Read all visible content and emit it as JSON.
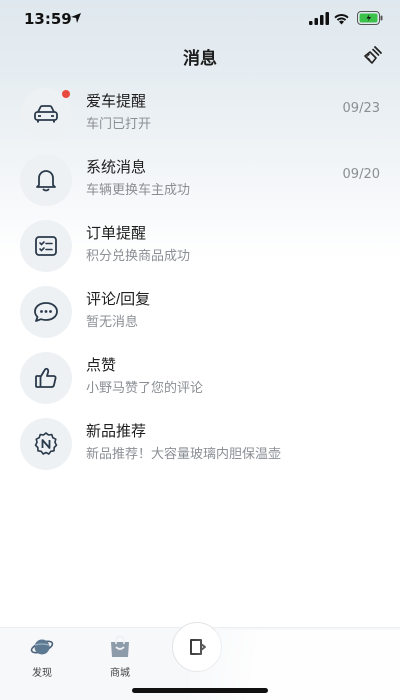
{
  "status_bar": {
    "time": "13:59"
  },
  "header": {
    "title": "消息",
    "clear_icon": "broom-icon"
  },
  "messages": [
    {
      "icon": "car-icon",
      "title": "爱车提醒",
      "subtitle": "车门已打开",
      "date": "09/23",
      "unread": true
    },
    {
      "icon": "bell-icon",
      "title": "系统消息",
      "subtitle": "车辆更换车主成功",
      "date": "09/20",
      "unread": false
    },
    {
      "icon": "order-list-icon",
      "title": "订单提醒",
      "subtitle": "积分兑换商品成功",
      "date": "",
      "unread": false
    },
    {
      "icon": "comment-bubble-icon",
      "title": "评论/回复",
      "subtitle": "暂无消息",
      "date": "",
      "unread": false
    },
    {
      "icon": "thumbs-up-icon",
      "title": "点赞",
      "subtitle": "小野马赞了您的评论",
      "date": "",
      "unread": false
    },
    {
      "icon": "new-product-badge-icon",
      "title": "新品推荐",
      "subtitle": "新品推荐！大容量玻璃内胆保温壶",
      "date": "",
      "unread": false
    }
  ],
  "tab_bar": {
    "tabs": [
      {
        "label": "发现",
        "icon": "planet-icon"
      },
      {
        "label": "商城",
        "icon": "shopping-bag-icon"
      }
    ]
  },
  "colors": {
    "unread_dot": "#e84a3b",
    "icon_bg": "#edf1f4",
    "subtitle": "#8b8f94"
  }
}
